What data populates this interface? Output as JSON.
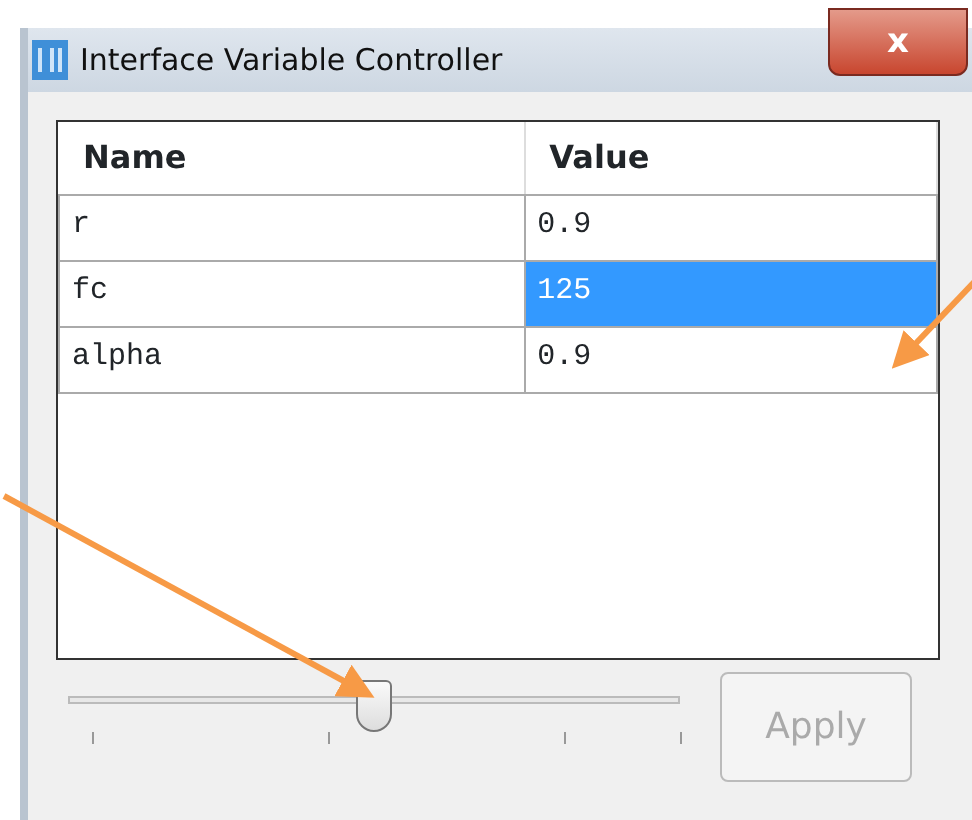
{
  "window": {
    "title": "Interface Variable Controller",
    "close_label": "x"
  },
  "table": {
    "columns": [
      "Name",
      "Value"
    ],
    "rows": [
      {
        "name": "r",
        "value": "0.9",
        "selected": false
      },
      {
        "name": "fc",
        "value": "125",
        "selected": true
      },
      {
        "name": "alpha",
        "value": "0.9",
        "selected": false
      }
    ]
  },
  "slider": {
    "level": 0.5
  },
  "apply_button": {
    "label": "Apply",
    "disabled": true
  }
}
